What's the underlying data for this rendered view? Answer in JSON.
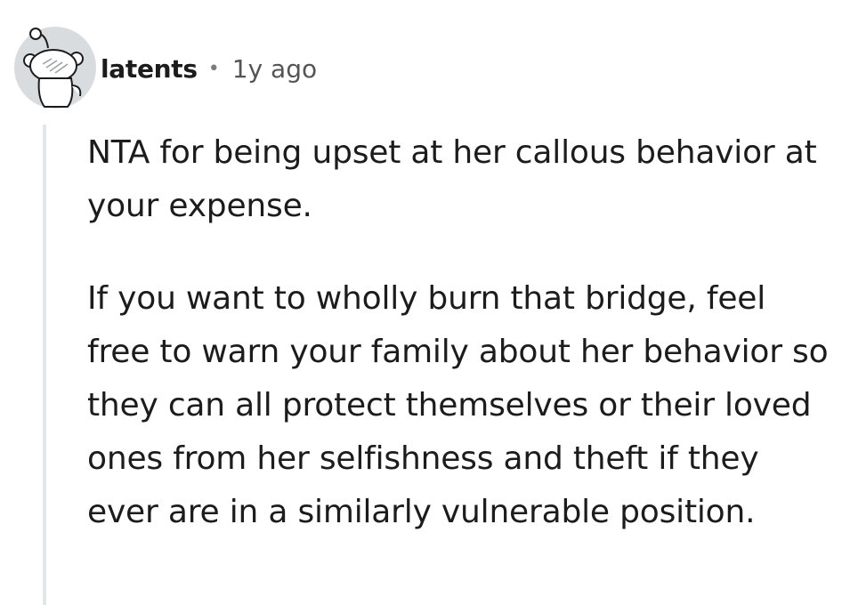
{
  "comment": {
    "author": "latents",
    "separator": "•",
    "timestamp": "1y ago",
    "avatar_icon": "snoo-avatar-icon",
    "paragraphs": [
      "NTA for being upset at her callous behavior at your expense.",
      "If you want to wholly burn that bridge, feel free to warn your family about her behavior so they can all protect themselves or their loved ones from her selfishness and theft if they ever are in a similarly vulnerable position."
    ]
  },
  "colors": {
    "text": "#1c1c1c",
    "meta": "#555555",
    "thread_line": "#e3e6e8",
    "avatar_bg": "#d9dcde"
  }
}
